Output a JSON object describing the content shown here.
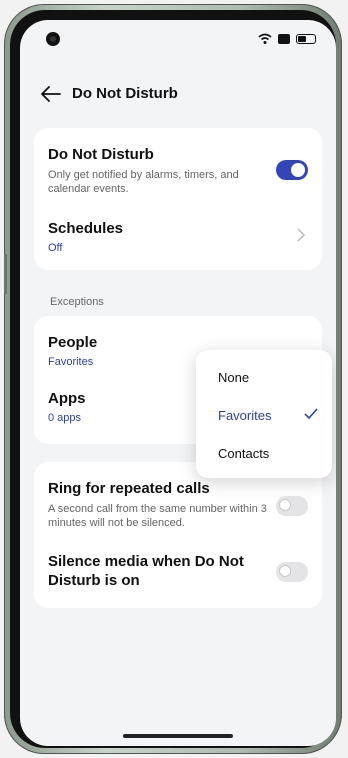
{
  "header": {
    "title": "Do Not Disturb"
  },
  "dnd": {
    "title": "Do Not Disturb",
    "description": "Only get notified by alarms, timers, and calendar events.",
    "enabled": true
  },
  "schedules": {
    "title": "Schedules",
    "value": "Off"
  },
  "exceptions": {
    "label": "Exceptions",
    "people": {
      "title": "People",
      "value": "Favorites"
    },
    "apps": {
      "title": "Apps",
      "value": "0 apps"
    }
  },
  "ring_repeated": {
    "title": "Ring for repeated calls",
    "description": "A second call from the same number within 3 minutes will not be silenced.",
    "enabled": false
  },
  "silence_media": {
    "title": "Silence media when Do Not Disturb is on",
    "enabled": false
  },
  "people_menu": {
    "options": [
      "None",
      "Favorites",
      "Contacts"
    ],
    "selected": "Favorites"
  },
  "colors": {
    "accent": "#3346b8",
    "background": "#f3f4f6"
  }
}
